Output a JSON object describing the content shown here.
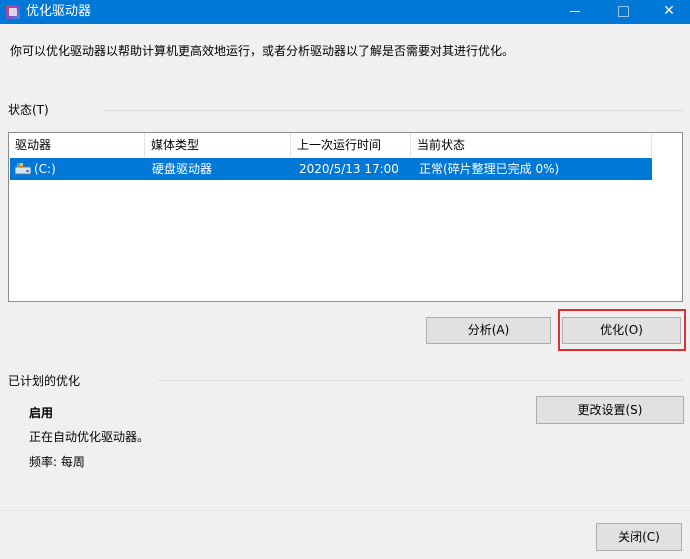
{
  "window": {
    "title": "优化驱动器",
    "buttons": {
      "minimize": "—",
      "maximize": "□",
      "close": "✕"
    }
  },
  "description": "你可以优化驱动器以帮助计算机更高效地运行，或者分析驱动器以了解是否需要对其进行优化。",
  "status": {
    "label": "状态(T)",
    "columns": [
      "驱动器",
      "媒体类型",
      "上一次运行时间",
      "当前状态"
    ],
    "rows": [
      {
        "drive": "(C:)",
        "media_type": "硬盘驱动器",
        "last_run": "2020/5/13 17:00",
        "current_status": "正常(碎片整理已完成 0%)",
        "icon": "hard-drive-icon",
        "selected": true
      }
    ],
    "analyze_button": "分析(A)",
    "optimize_button": "优化(O)"
  },
  "scheduled": {
    "label": "已计划的优化",
    "state": "启用",
    "info": "正在自动优化驱动器。",
    "frequency": "频率: 每周",
    "change_settings_button": "更改设置(S)"
  },
  "close_button": "关闭(C)",
  "colors": {
    "titlebar": "#0078d7",
    "selection": "#0078d7",
    "highlight_box": "#e03030",
    "background": "#f0f0f0"
  }
}
